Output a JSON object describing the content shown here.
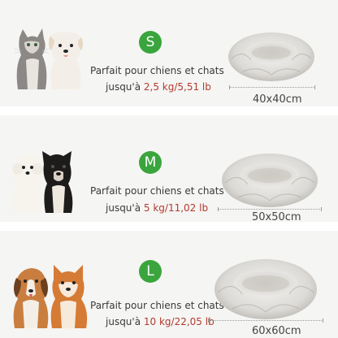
{
  "sizes": [
    {
      "badge": "S",
      "pets": "cat-and-dog",
      "line1": "Parfait pour chiens et chats",
      "prefix": "jusqu'à ",
      "weight": "2,5 kg/5,51 lb",
      "dimension": "40x40cm"
    },
    {
      "badge": "M",
      "pets": "white-poodle-and-french-bulldog",
      "line1": "Parfait pour chiens et chats",
      "prefix": "jusqu'à ",
      "weight": "5 kg/11,02 lb",
      "dimension": "50x50cm"
    },
    {
      "badge": "L",
      "pets": "beagle-and-shiba-inu",
      "line1": "Parfait pour chiens et chats",
      "prefix": "jusqu'à ",
      "weight": "10 kg/22,05 lb",
      "dimension": "60x60cm"
    }
  ],
  "colors": {
    "badge": "#3aa53c",
    "weight": "#b23b2e",
    "panel": "#f5f5f4",
    "bed": "#e2e0dd"
  }
}
